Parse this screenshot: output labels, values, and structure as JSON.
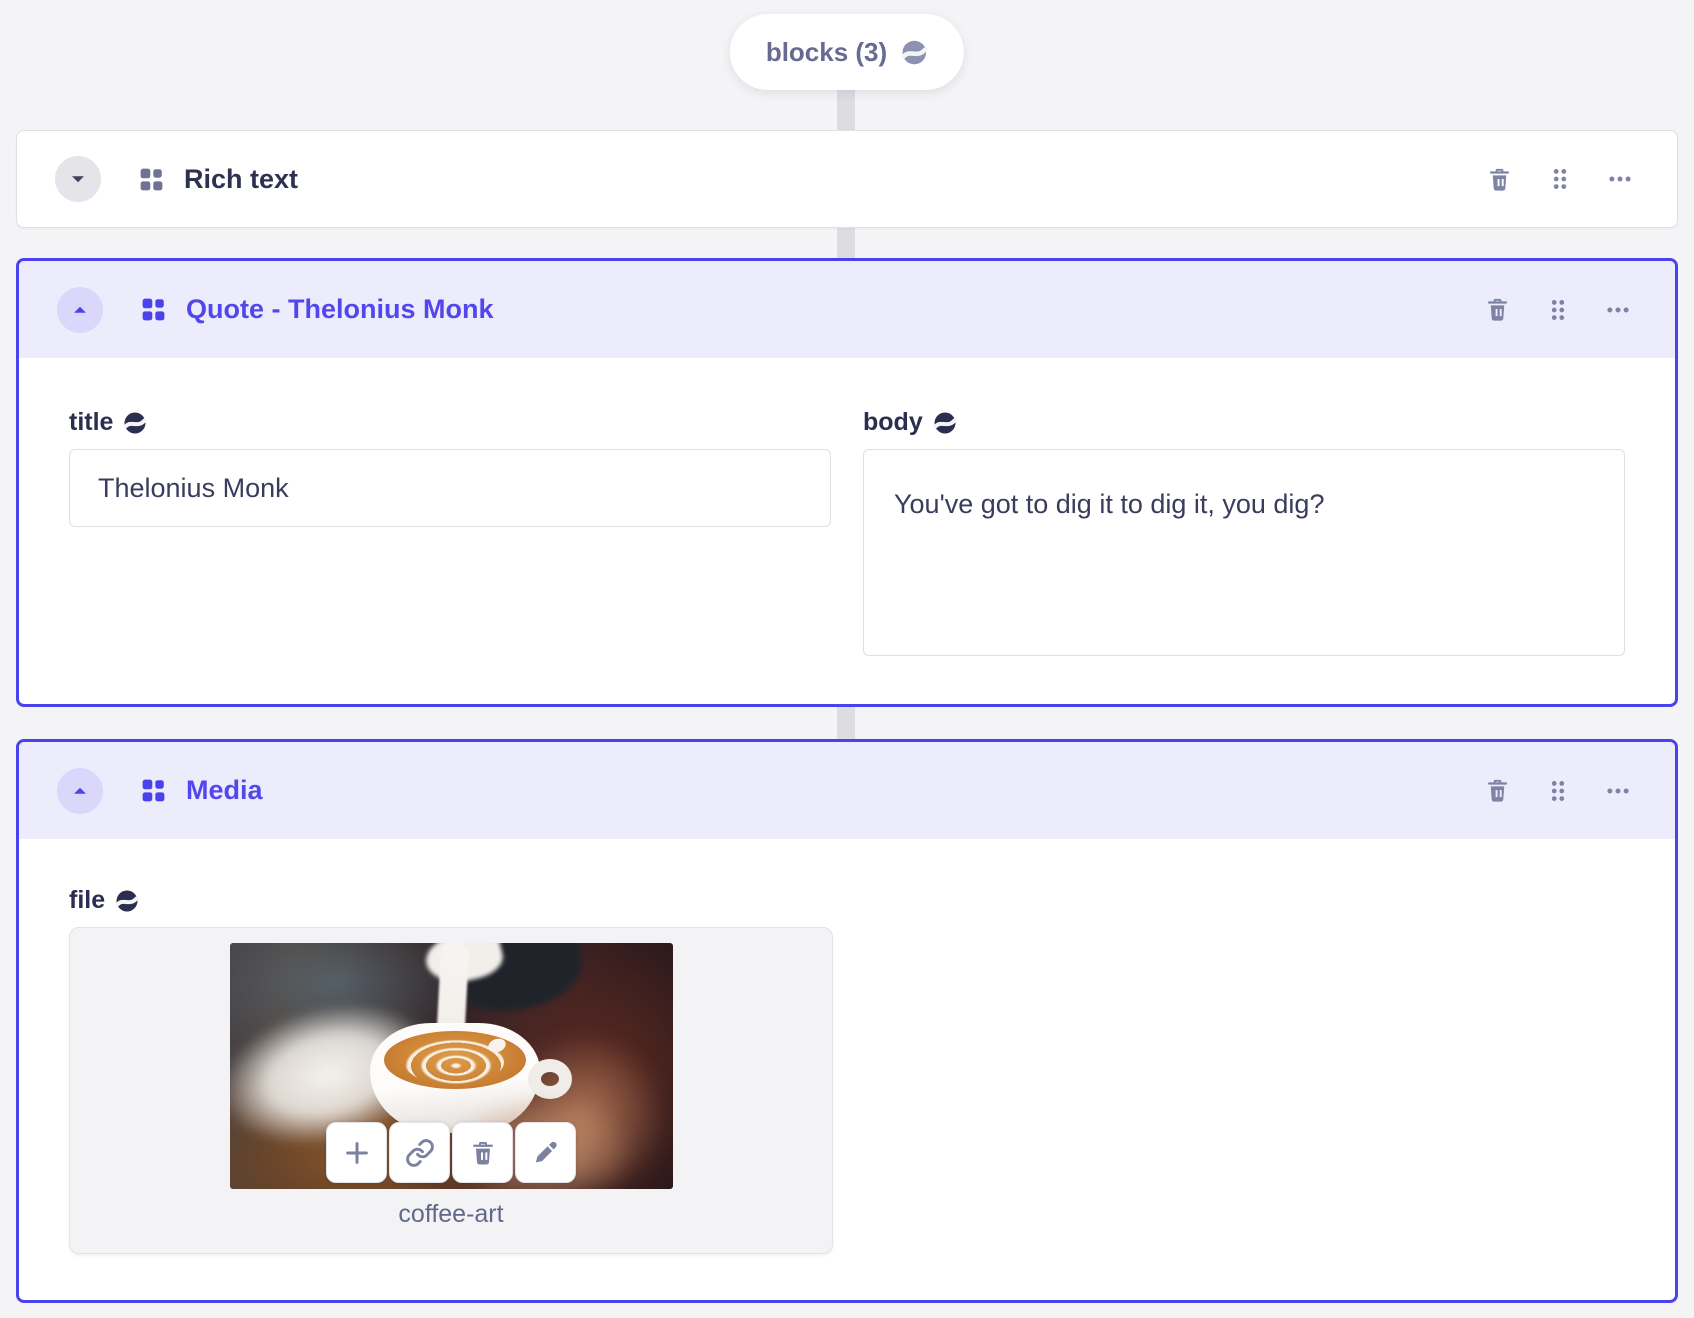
{
  "pill": {
    "label": "blocks (3)"
  },
  "blocks": [
    {
      "title": "Rich text",
      "state": "collapsed"
    },
    {
      "title": "Quote - Thelonius Monk",
      "state": "expanded",
      "fields": [
        {
          "label": "title",
          "value": "Thelonius Monk"
        },
        {
          "label": "body",
          "value": "You've got to dig it to dig it, you dig?"
        }
      ]
    },
    {
      "title": "Media",
      "state": "expanded",
      "fields": [
        {
          "label": "file",
          "file_name": "coffee-art"
        }
      ]
    }
  ],
  "icons": {
    "globe": "globe-icon",
    "blocks_grid": "blocks-grid-icon",
    "chevron_down": "chevron-down-icon",
    "chevron_up": "chevron-up-icon",
    "trash": "trash-icon",
    "drag_handle": "drag-dots-icon",
    "more": "ellipsis-icon",
    "plus": "plus-icon",
    "link": "link-icon",
    "pencil": "pencil-icon"
  },
  "colors": {
    "page_bg": "#f4f4f6",
    "accent_border": "#4a42ec",
    "selected_header_bg": "#edecfd",
    "accent_text": "#5247ee",
    "plain_title_text": "#2f3150",
    "icon_slate": "#7e82a3",
    "connector": "#dcdde1"
  }
}
